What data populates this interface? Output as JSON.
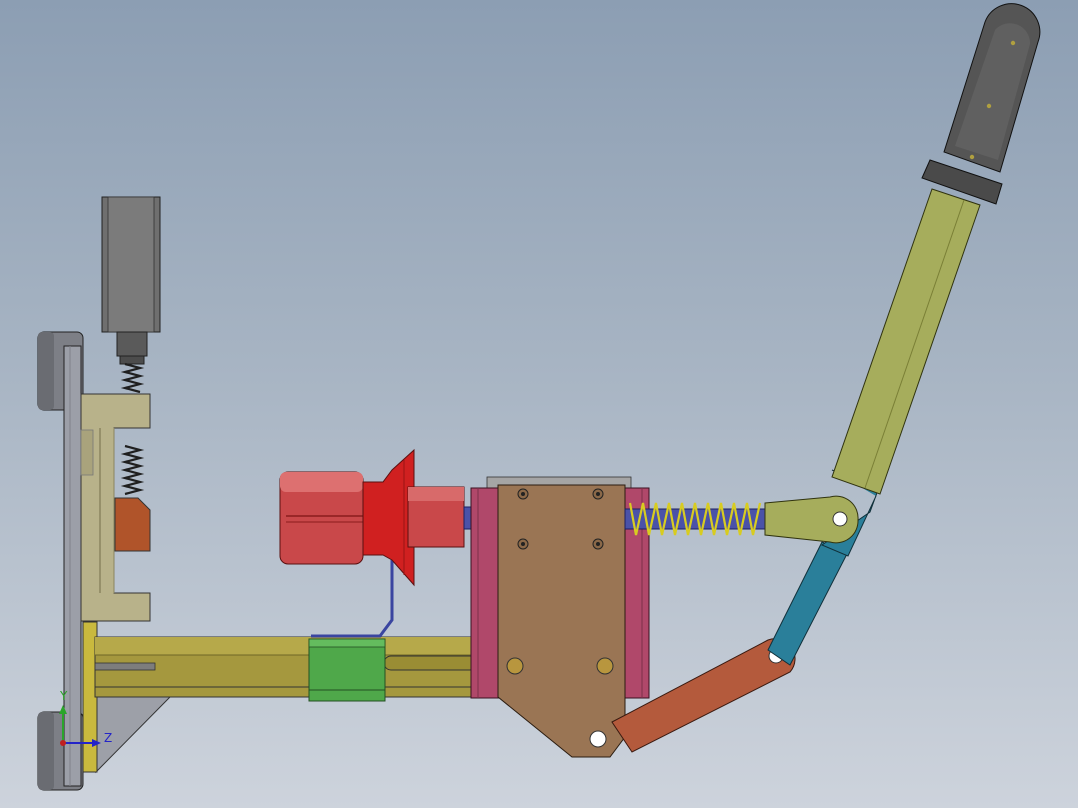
{
  "viewport": {
    "background_top": "#8c9eb3",
    "background_bottom": "#cdd3dc"
  },
  "triad": {
    "y_label": "Y",
    "z_label": "Z",
    "y_color": "#2aa52a",
    "z_color": "#2424c8",
    "origin_color": "#c02020"
  },
  "colors": {
    "frame_plate": "#9c9fa8",
    "rail": "#a5983e",
    "clamp_body": "#b8b28a",
    "clamp_jaw": "#b0542a",
    "actuator": "#6a6a6a",
    "red_knob": "#d02020",
    "slider_block": "#4fa84a",
    "housing": "#b0486a",
    "bracket": "#9a7554",
    "spring": "#d8cc20",
    "rod": "#4a52a8",
    "lever_arm": "#a6ad5c",
    "link_blue": "#2a7f9a",
    "link_orange": "#b45a3c",
    "grip": "#555555"
  }
}
